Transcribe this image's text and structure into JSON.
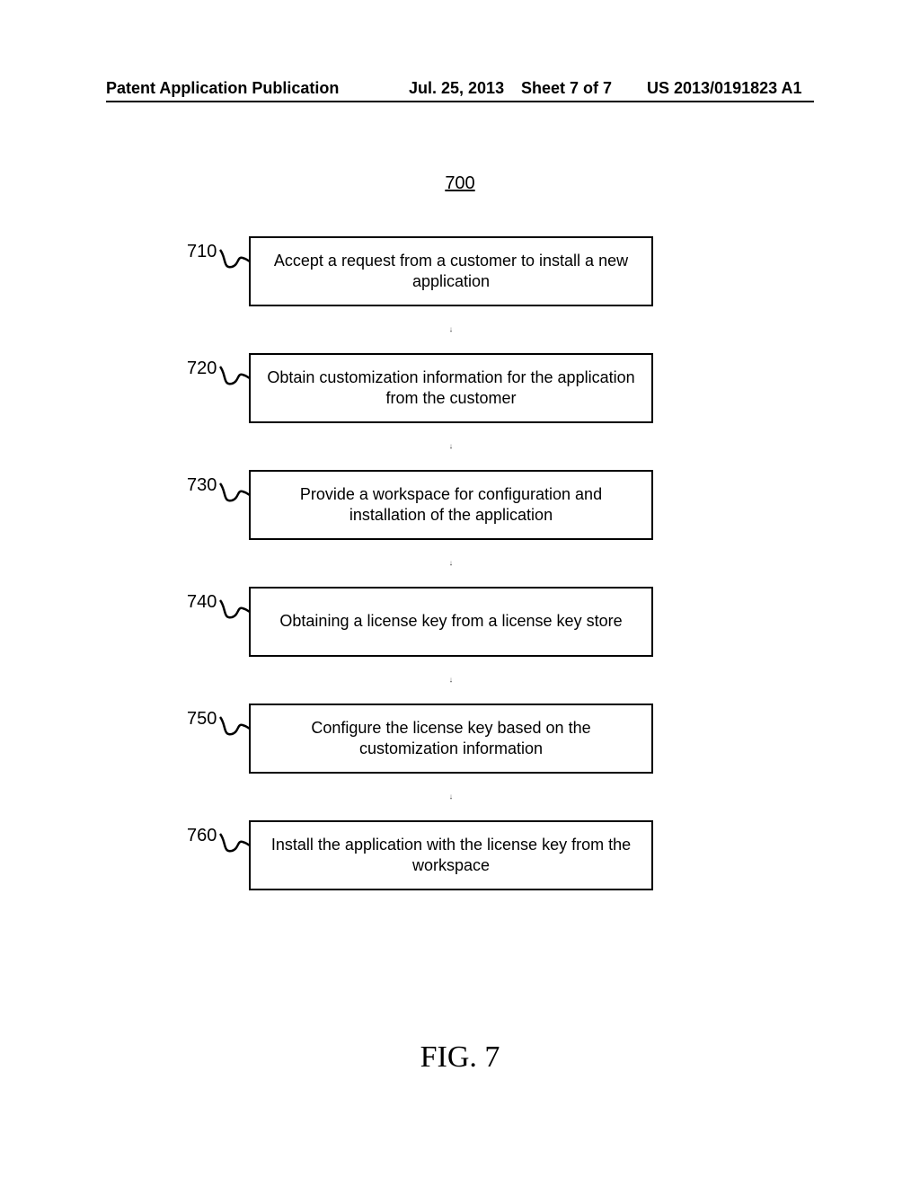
{
  "header": {
    "publication_label": "Patent Application Publication",
    "date": "Jul. 25, 2013",
    "sheet": "Sheet 7 of 7",
    "docnum": "US 2013/0191823 A1"
  },
  "figure_ref": "700",
  "figure_caption": "FIG. 7",
  "steps": [
    {
      "num": "710",
      "text": "Accept a request from a customer to install a new application"
    },
    {
      "num": "720",
      "text": "Obtain customization information for the application from the customer"
    },
    {
      "num": "730",
      "text": "Provide a workspace for configuration and installation of the application"
    },
    {
      "num": "740",
      "text": "Obtaining a license key from a license key store"
    },
    {
      "num": "750",
      "text": "Configure the license key based on the customization information"
    },
    {
      "num": "760",
      "text": "Install the application with the license key from the workspace"
    }
  ],
  "chart_data": {
    "type": "flowchart",
    "title": "700",
    "nodes": [
      {
        "id": "710",
        "label": "Accept a request from a customer to install a new application"
      },
      {
        "id": "720",
        "label": "Obtain customization information for the application from the customer"
      },
      {
        "id": "730",
        "label": "Provide a workspace for configuration and installation of the application"
      },
      {
        "id": "740",
        "label": "Obtaining a license key from a license key store"
      },
      {
        "id": "750",
        "label": "Configure the license key based on the customization information"
      },
      {
        "id": "760",
        "label": "Install the application with the license key from the workspace"
      }
    ],
    "edges": [
      {
        "from": "710",
        "to": "720"
      },
      {
        "from": "720",
        "to": "730"
      },
      {
        "from": "730",
        "to": "740"
      },
      {
        "from": "740",
        "to": "750"
      },
      {
        "from": "750",
        "to": "760"
      }
    ]
  }
}
